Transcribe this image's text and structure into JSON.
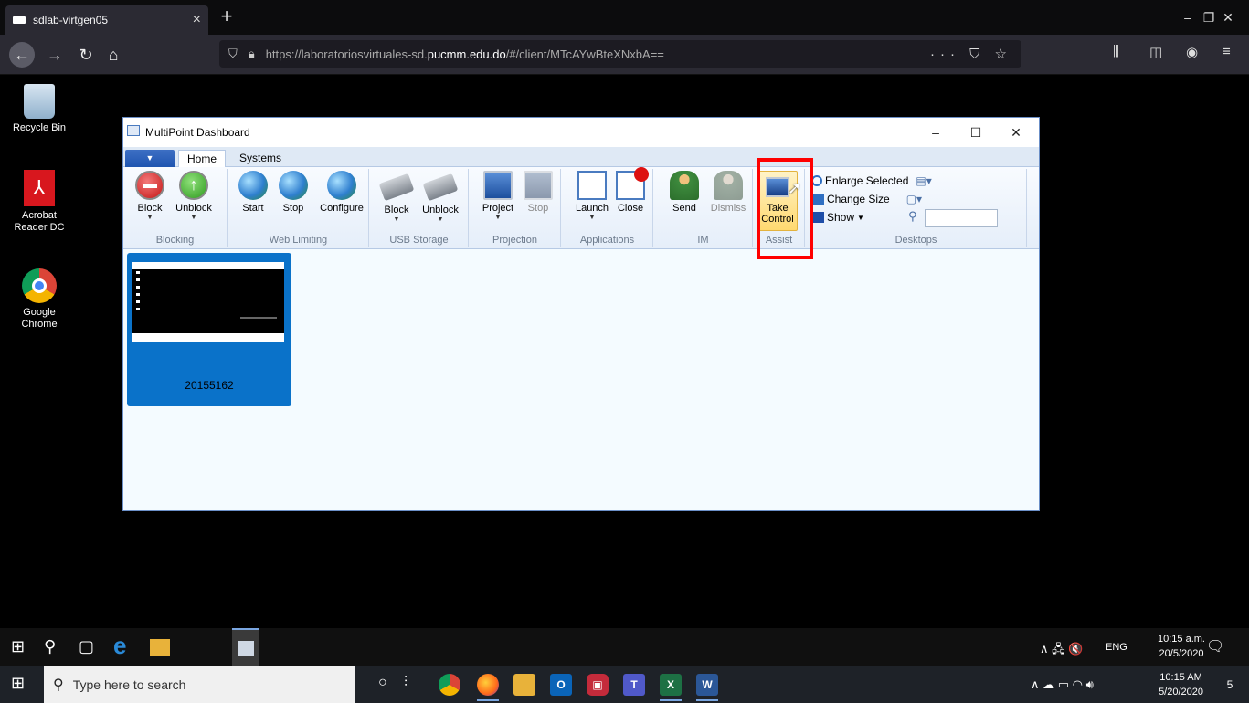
{
  "browser": {
    "tab_title": "sdlab-virtgen05",
    "tab_close": "×",
    "new_tab": "+",
    "url_prefix": "https://laboratoriosvirtuales-sd.",
    "url_domain": "pucmm.edu.do",
    "url_suffix": "/#/client/MTcAYwBteXNxbA==",
    "url_actions": "··· ⛉ ☆"
  },
  "desktop": {
    "icons": [
      {
        "label": "Recycle Bin"
      },
      {
        "label": "Acrobat Reader DC"
      },
      {
        "label": "Google Chrome"
      }
    ]
  },
  "window": {
    "title": "MultiPoint Dashboard",
    "minimize": "–",
    "maximize": "☐",
    "close": "✕",
    "file_menu": "▼",
    "tabs": [
      {
        "label": "Home"
      },
      {
        "label": "Systems"
      }
    ]
  },
  "ribbon": {
    "groups": {
      "blocking": "Blocking",
      "web_limiting": "Web Limiting",
      "usb_storage": "USB Storage",
      "projection": "Projection",
      "applications": "Applications",
      "im": "IM",
      "assist": "Assist",
      "desktops": "Desktops"
    },
    "buttons": {
      "block": "Block",
      "unblock": "Unblock",
      "start": "Start",
      "stop": "Stop",
      "configure": "Configure",
      "usb_block": "Block",
      "usb_unblock": "Unblock",
      "project": "Project",
      "proj_stop": "Stop",
      "launch": "Launch",
      "close": "Close",
      "send": "Send",
      "dismiss": "Dismiss",
      "take_control_1": "Take",
      "take_control_2": "Control",
      "enlarge_selected": "Enlarge Selected",
      "change_size": "Change Size",
      "show": "Show"
    },
    "search_placeholder": ""
  },
  "stations": [
    {
      "name": "20155162"
    }
  ],
  "remote_taskbar": {
    "lang": "ENG",
    "time": "10:15 a.m.",
    "date": "20/5/2020"
  },
  "host_taskbar": {
    "search_placeholder": "Type here to search",
    "time": "10:15 AM",
    "date": "5/20/2020",
    "notifications": "5"
  }
}
